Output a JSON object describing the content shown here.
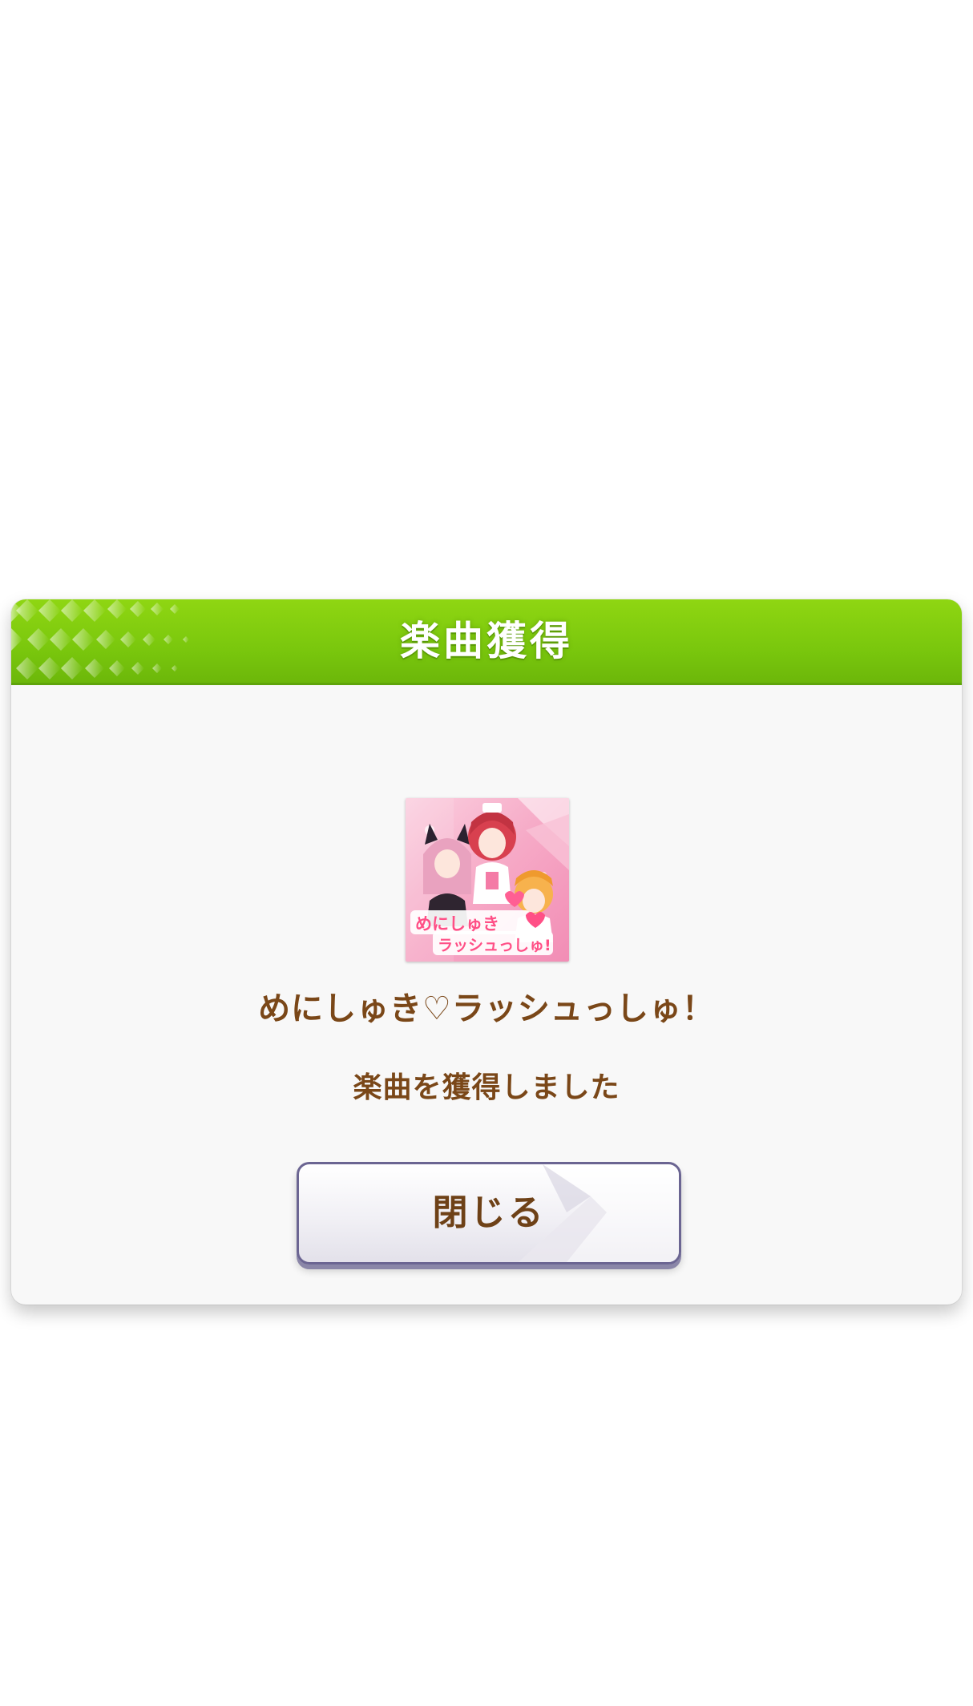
{
  "dialog": {
    "title": "楽曲獲得",
    "song_title": "めにしゅき♡ラッシュっしゅ！",
    "message": "楽曲を獲得しました",
    "close_label": "閉じる",
    "jacket_logo_line1": "めにしゅき",
    "jacket_logo_line2": "ラッシュっしゅ!"
  },
  "colors": {
    "header_green": "#7ac70d",
    "text_brown": "#7a4718",
    "button_border": "#6b6592",
    "jacket_pink": "#f6a9c6"
  }
}
